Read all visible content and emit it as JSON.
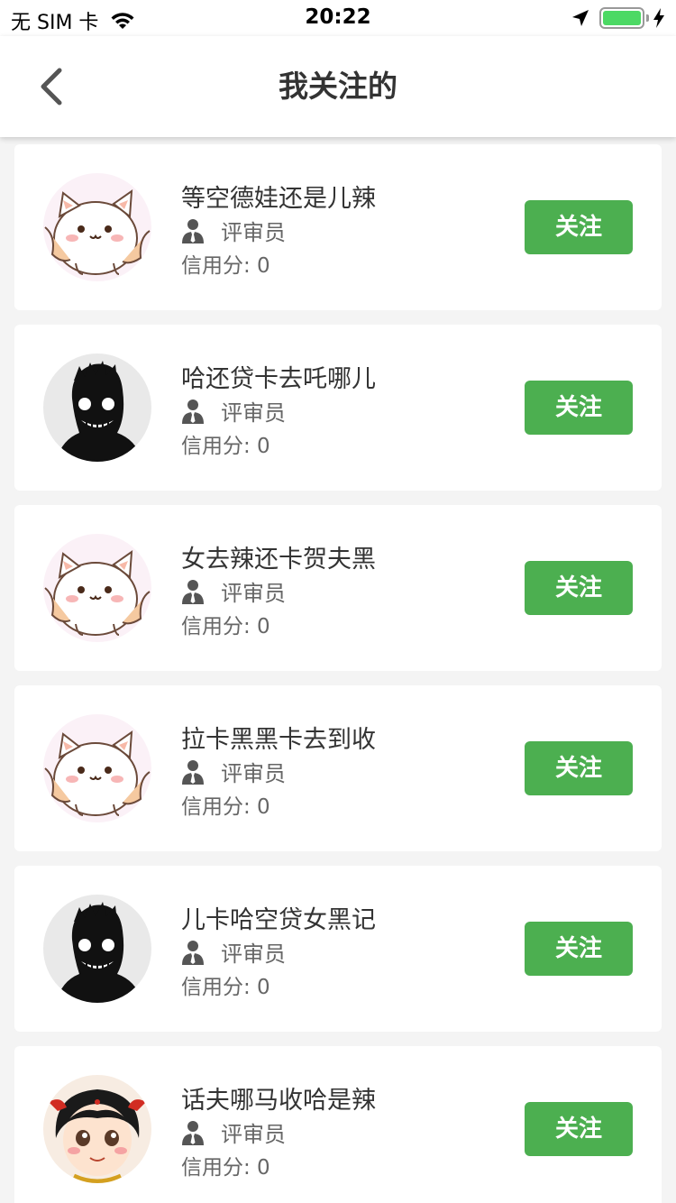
{
  "status_bar": {
    "carrier": "无 SIM 卡",
    "time": "20:22",
    "icons": [
      "wifi-icon",
      "location-icon",
      "battery-icon",
      "charging-icon"
    ],
    "battery_level": 1.0
  },
  "nav": {
    "title": "我关注的",
    "back_icon": "chevron-left-icon"
  },
  "colors": {
    "accent": "#4caf50",
    "background": "#f4f4f4",
    "card": "#ffffff"
  },
  "list": [
    {
      "name": "等空德娃还是儿辣",
      "role": "评审员",
      "credit": "信用分:  0",
      "follow_label": "关注",
      "avatar": "cat"
    },
    {
      "name": "哈还贷卡去吒哪儿",
      "role": "评审员",
      "credit": "信用分:  0",
      "follow_label": "关注",
      "avatar": "shadow"
    },
    {
      "name": "女去辣还卡贺夫黑",
      "role": "评审员",
      "credit": "信用分:  0",
      "follow_label": "关注",
      "avatar": "cat"
    },
    {
      "name": "拉卡黑黑卡去到收",
      "role": "评审员",
      "credit": "信用分:  0",
      "follow_label": "关注",
      "avatar": "cat"
    },
    {
      "name": "儿卡哈空贷女黑记",
      "role": "评审员",
      "credit": "信用分:  0",
      "follow_label": "关注",
      "avatar": "shadow"
    },
    {
      "name": "话夫哪马收哈是辣",
      "role": "评审员",
      "credit": "信用分:  0",
      "follow_label": "关注",
      "avatar": "girl"
    }
  ]
}
